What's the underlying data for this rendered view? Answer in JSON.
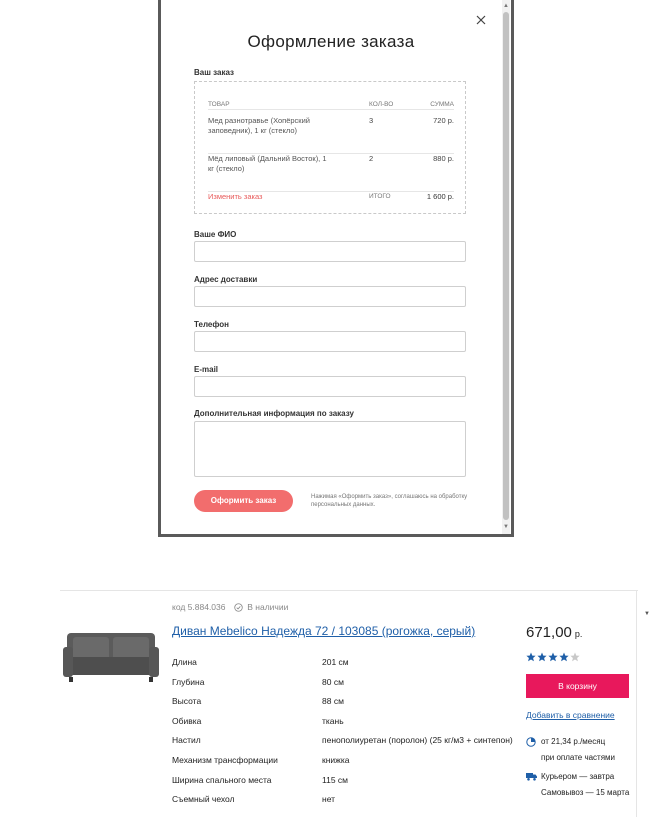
{
  "modal": {
    "title": "Оформление заказа",
    "order_section_label": "Ваш заказ",
    "columns": {
      "product": "ТОВАР",
      "qty": "КОЛ-ВО",
      "sum": "СУММА"
    },
    "items": [
      {
        "name": "Мед разнотравье (Хопёрский заповедник), 1 кг (стекло)",
        "qty": "3",
        "sum": "720 р."
      },
      {
        "name": "Мёд липовый (Дальний Восток), 1 кг (стекло)",
        "qty": "2",
        "sum": "880 р."
      }
    ],
    "edit_order": "Изменить заказ",
    "total_label": "ИТОГО",
    "total_value": "1 600 р.",
    "fields": {
      "name_label": "Ваше ФИО",
      "address_label": "Адрес доставки",
      "phone_label": "Телефон",
      "email_label": "E-mail",
      "extra_label": "Дополнительная информация по заказу"
    },
    "submit_label": "Оформить заказ",
    "consent": "Нажимая «Оформить заказ», соглашаюсь на обработку персональных данных."
  },
  "product": {
    "code": "код 5.884.036",
    "availability": "В наличии",
    "title": "Диван Mebelico Надежда 72 / 103085 (рогожка, серый)",
    "specs": [
      {
        "name": "Длина",
        "value": "201 см"
      },
      {
        "name": "Глубина",
        "value": "80 см"
      },
      {
        "name": "Высота",
        "value": "88 см"
      },
      {
        "name": "Обивка",
        "value": "ткань"
      },
      {
        "name": "Настил",
        "value": "пенополиуретан (поролон) (25 кг/м3 + синтепон)"
      },
      {
        "name": "Механизм трансформации",
        "value": "книжка"
      },
      {
        "name": "Ширина спального места",
        "value": "115 см"
      },
      {
        "name": "Съемный чехол",
        "value": "нет"
      }
    ],
    "price": "671,00",
    "currency": "р.",
    "rating_stars": 4,
    "rating_max": 5,
    "cart_label": "В корзину",
    "compare_label": "Добавить в сравнение",
    "installment_line1": "от 21,34 р./месяц",
    "installment_line2": "при оплате частями",
    "delivery_line1": "Курьером — завтра",
    "delivery_line2": "Самовывоз — 15 марта",
    "accent_color": "#e8185c",
    "link_color": "#1f5fa8"
  }
}
